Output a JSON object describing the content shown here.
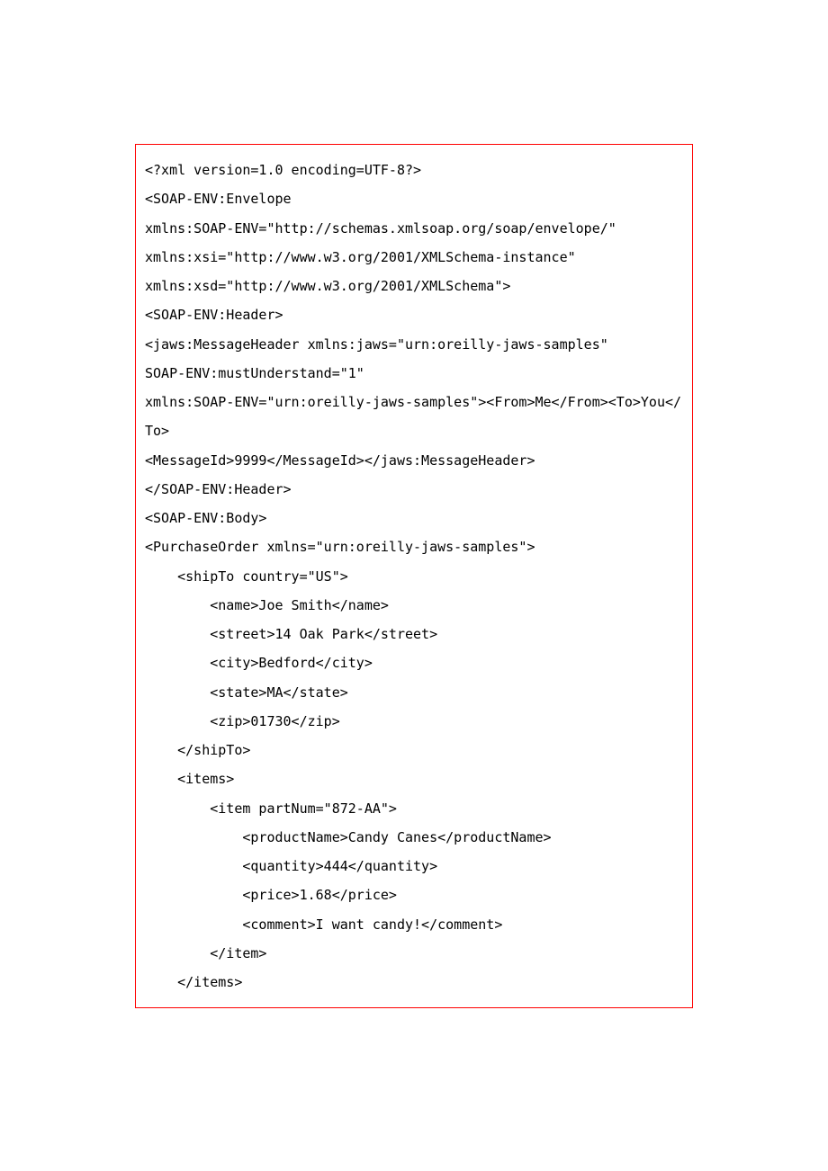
{
  "code": {
    "lines": [
      "<?xml version=1.0 encoding=UTF-8?>",
      "<SOAP-ENV:Envelope",
      "xmlns:SOAP-ENV=\"http://schemas.xmlsoap.org/soap/envelope/\"",
      "xmlns:xsi=\"http://www.w3.org/2001/XMLSchema-instance\"",
      "xmlns:xsd=\"http://www.w3.org/2001/XMLSchema\">",
      "<SOAP-ENV:Header>",
      "<jaws:MessageHeader xmlns:jaws=\"urn:oreilly-jaws-samples\"",
      "SOAP-ENV:mustUnderstand=\"1\"",
      "xmlns:SOAP-ENV=\"urn:oreilly-jaws-samples\"><From>Me</From><To>You</To>",
      "<MessageId>9999</MessageId></jaws:MessageHeader>",
      "</SOAP-ENV:Header>",
      "<SOAP-ENV:Body>",
      "<PurchaseOrder xmlns=\"urn:oreilly-jaws-samples\">",
      "    <shipTo country=\"US\">",
      "        <name>Joe Smith</name>",
      "        <street>14 Oak Park</street>",
      "        <city>Bedford</city>",
      "        <state>MA</state>",
      "        <zip>01730</zip>",
      "    </shipTo>",
      "    <items>",
      "        <item partNum=\"872-AA\">",
      "            <productName>Candy Canes</productName>",
      "            <quantity>444</quantity>",
      "            <price>1.68</price>",
      "            <comment>I want candy!</comment>",
      "        </item>",
      "    </items>"
    ]
  }
}
